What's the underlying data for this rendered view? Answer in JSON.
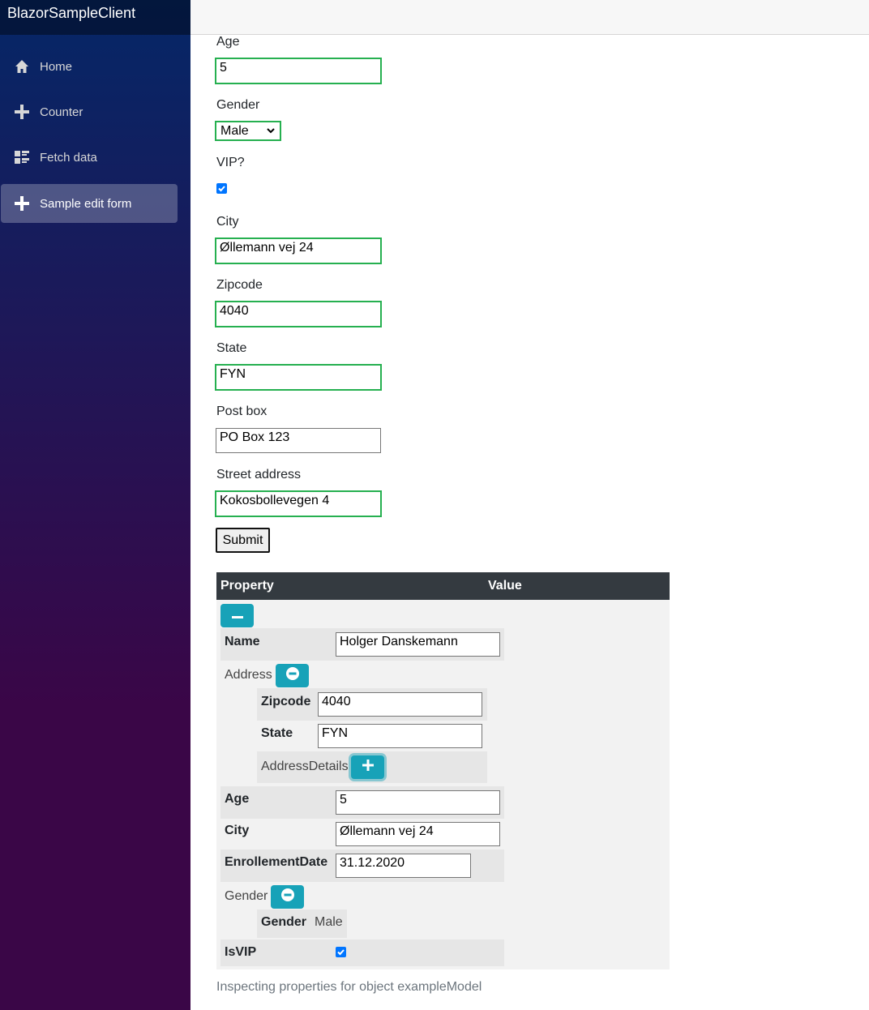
{
  "app": {
    "brand": "BlazorSampleClient"
  },
  "nav": [
    {
      "label": "Home",
      "icon": "home-icon"
    },
    {
      "label": "Counter",
      "icon": "plus-icon"
    },
    {
      "label": "Fetch data",
      "icon": "list-rich-icon"
    },
    {
      "label": "Sample edit form",
      "icon": "plus-icon",
      "active": true
    }
  ],
  "form": {
    "age_label": "Age",
    "age_value": "5",
    "gender_label": "Gender",
    "gender_value": "Male",
    "vip_label": "VIP?",
    "vip_checked": true,
    "city_label": "City",
    "city_value": "Øllemann vej 24",
    "zipcode_label": "Zipcode",
    "zipcode_value": "4040",
    "state_label": "State",
    "state_value": "FYN",
    "postbox_label": "Post box",
    "postbox_value": "PO Box 123",
    "street_label": "Street address",
    "street_value": "Kokosbollevegen 4",
    "submit_label": "Submit"
  },
  "inspector": {
    "col_property": "Property",
    "col_value": "Value",
    "name_label": "Name",
    "name_value": "Holger Danskemann",
    "address_label": "Address",
    "zipcode_label": "Zipcode",
    "zipcode_value": "4040",
    "state_label": "State",
    "state_value": "FYN",
    "addressdetails_label": "AddressDetails",
    "age_label": "Age",
    "age_value": "5",
    "city_label": "City",
    "city_value": "Øllemann vej 24",
    "enrollment_label": "EnrollementDate",
    "enrollment_value": "31.12.2020",
    "gender_group_label": "Gender",
    "gender_label": "Gender",
    "gender_value": "Male",
    "isvip_label": "IsVIP",
    "isvip_checked": true,
    "footer": "Inspecting properties for object exampleModel"
  },
  "colors": {
    "accent": "#17a2b8",
    "valid": "#26b050",
    "header": "#343a40"
  }
}
